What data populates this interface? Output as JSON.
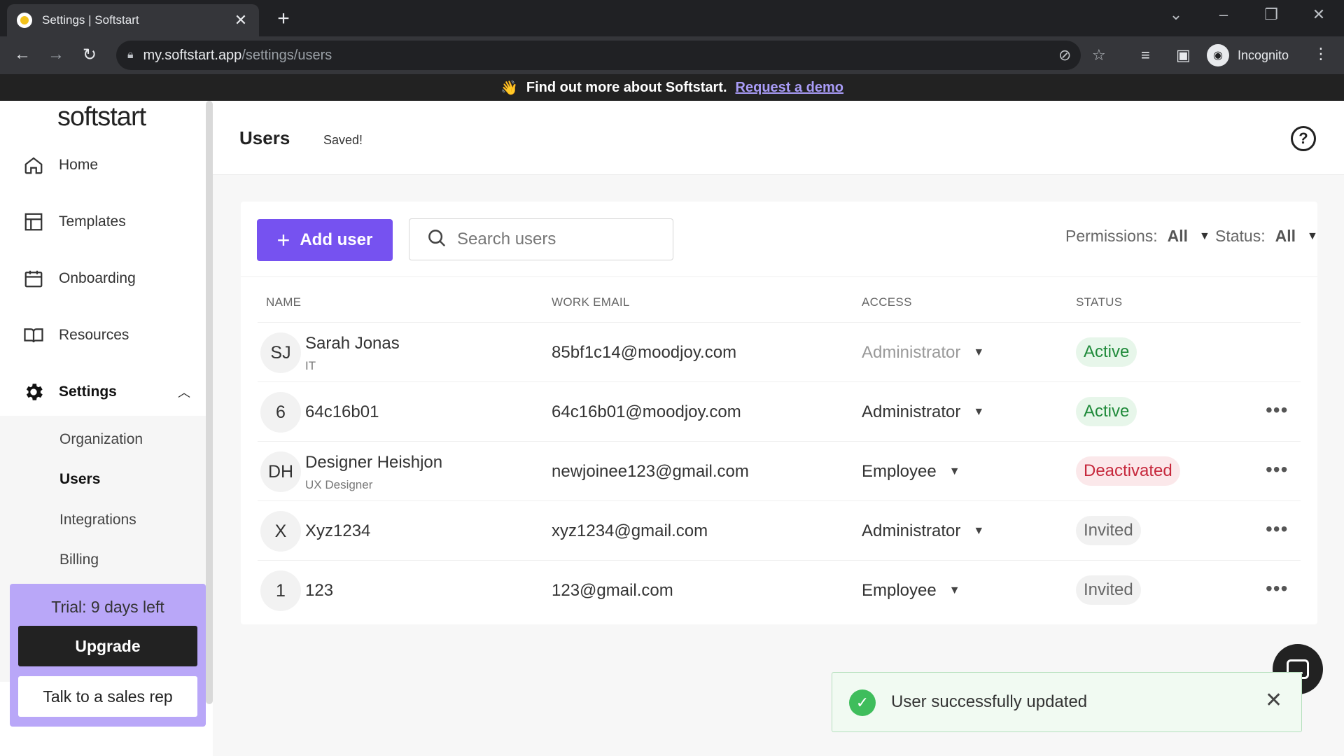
{
  "browser": {
    "tab_title": "Settings | Softstart",
    "url_host": "my.softstart.app",
    "url_path": "/settings/users",
    "profile_label": "Incognito"
  },
  "banner": {
    "emoji": "👋",
    "text": "Find out more about Softstart.",
    "link": "Request a demo"
  },
  "sidebar": {
    "logo": "softstart",
    "nav": {
      "home": "Home",
      "templates": "Templates",
      "onboarding": "Onboarding",
      "resources": "Resources",
      "settings": "Settings"
    },
    "settings_sub": {
      "organization": "Organization",
      "users": "Users",
      "integrations": "Integrations",
      "billing": "Billing"
    },
    "trial": {
      "text": "Trial: 9 days left",
      "upgrade": "Upgrade",
      "sales": "Talk to a sales rep"
    }
  },
  "header": {
    "title": "Users",
    "saved": "Saved!",
    "help": "?"
  },
  "toolbar": {
    "add_user": "Add user",
    "search_placeholder": "Search users",
    "permissions_label": "Permissions:",
    "permissions_value": "All",
    "status_label": "Status:",
    "status_value": "All"
  },
  "table": {
    "columns": {
      "name": "NAME",
      "email": "WORK EMAIL",
      "access": "ACCESS",
      "status": "STATUS"
    },
    "rows": [
      {
        "initials": "SJ",
        "name": "Sarah Jonas",
        "sub": "IT",
        "email": "85bf1c14@moodjoy.com",
        "access": "Administrator",
        "status": "Active"
      },
      {
        "initials": "6",
        "name": "64c16b01",
        "sub": "",
        "email": "64c16b01@moodjoy.com",
        "access": "Administrator",
        "status": "Active"
      },
      {
        "initials": "DH",
        "name": "Designer Heishjon",
        "sub": "UX Designer",
        "email": "newjoinee123@gmail.com",
        "access": "Employee",
        "status": "Deactivated"
      },
      {
        "initials": "X",
        "name": "Xyz1234",
        "sub": "",
        "email": "xyz1234@gmail.com",
        "access": "Administrator",
        "status": "Invited"
      },
      {
        "initials": "1",
        "name": "123",
        "sub": "",
        "email": "123@gmail.com",
        "access": "Employee",
        "status": "Invited"
      }
    ]
  },
  "toast": {
    "message": "User successfully updated"
  },
  "colors": {
    "accent": "#7652f0",
    "trial_bg": "#b9a7f8",
    "active": "#1f8a3a",
    "deactivated": "#c6283c",
    "success": "#3fbd5c"
  }
}
